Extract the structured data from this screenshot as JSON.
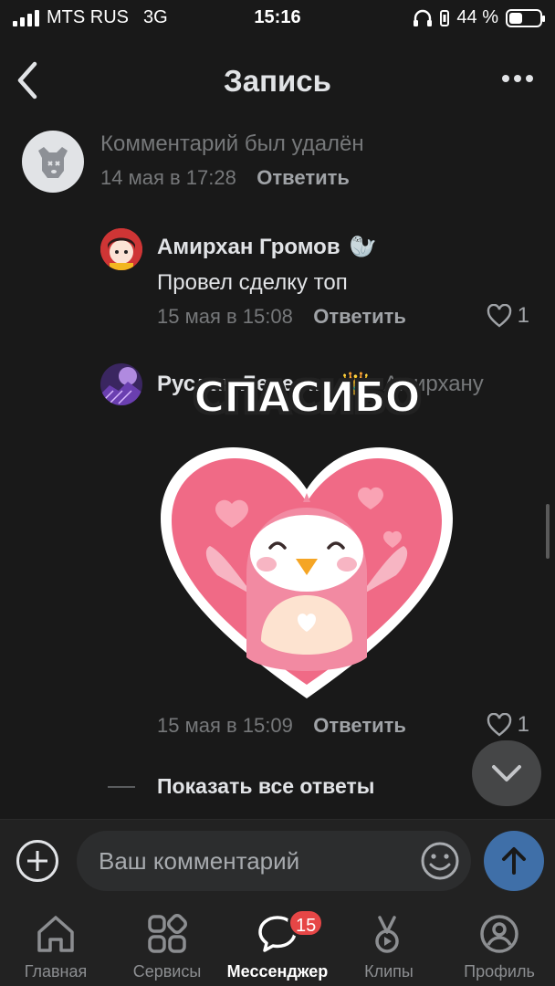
{
  "status_bar": {
    "carrier": "MTS RUS",
    "network": "3G",
    "time": "15:16",
    "battery": "44 %",
    "battery_level": 0.44
  },
  "header": {
    "title": "Запись"
  },
  "comments": [
    {
      "text": "Комментарий был удалён",
      "date": "14 мая в 17:28",
      "reply_label": "Ответить"
    },
    {
      "author": "Амирхан Громов",
      "author_badge": "🦭",
      "text": "Провел сделку топ",
      "date": "15 мая в 15:08",
      "reply_label": "Ответить",
      "likes": "1"
    },
    {
      "author": "Руслан Лепест...",
      "author_badge": "👑",
      "reply_to": "Амирхану",
      "sticker_caption": "СПАСИБО",
      "date": "15 мая в 15:09",
      "reply_label": "Ответить",
      "likes": "1"
    }
  ],
  "show_all_replies": "Показать все ответы",
  "composer": {
    "placeholder": "Ваш комментарий"
  },
  "tabbar": {
    "tabs": [
      {
        "label": "Главная",
        "icon": "home-icon"
      },
      {
        "label": "Сервисы",
        "icon": "services-icon"
      },
      {
        "label": "Мессенджер",
        "icon": "messenger-icon",
        "badge": "15",
        "active": true
      },
      {
        "label": "Клипы",
        "icon": "clips-icon"
      },
      {
        "label": "Профиль",
        "icon": "profile-icon"
      }
    ]
  },
  "colors": {
    "background": "#191919",
    "text_primary": "#e1e3e6",
    "text_secondary": "#76787a",
    "accent_send": "#3f6fa8",
    "badge": "#e64646",
    "sticker_heart": "#f06a86"
  }
}
